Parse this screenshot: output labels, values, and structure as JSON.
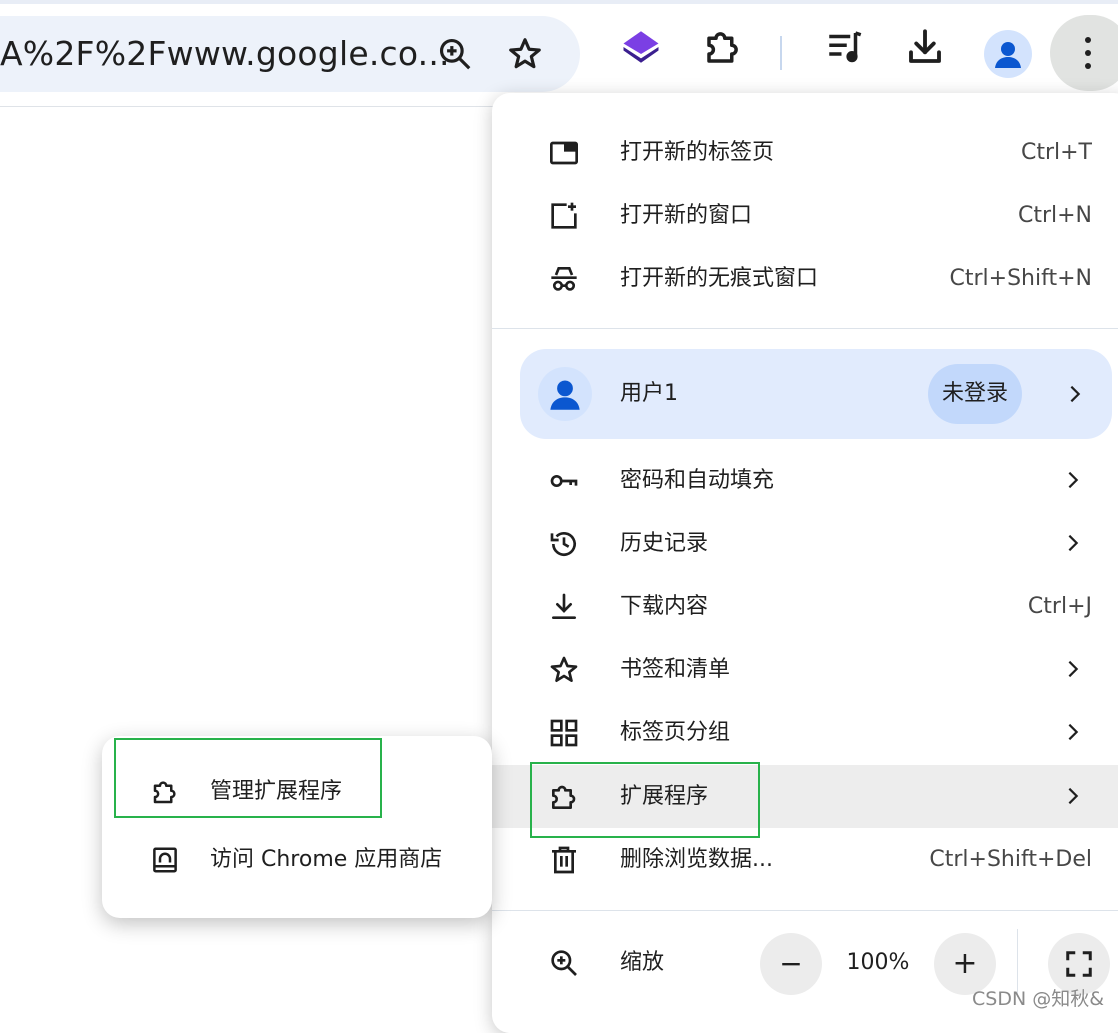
{
  "toolbar": {
    "url": "A%2F%2Fwww.google.co...",
    "icons": [
      "zoom-in-icon",
      "bookmark-star-icon",
      "extension-app-icon",
      "extensions-icon",
      "media-playlist-icon",
      "download-icon",
      "profile-avatar-icon",
      "more-menu-icon"
    ]
  },
  "menu": {
    "new_tab": {
      "label": "打开新的标签页",
      "shortcut": "Ctrl+T"
    },
    "new_window": {
      "label": "打开新的窗口",
      "shortcut": "Ctrl+N"
    },
    "incognito": {
      "label": "打开新的无痕式窗口",
      "shortcut": "Ctrl+Shift+N"
    },
    "profile": {
      "name": "用户1",
      "status": "未登录"
    },
    "passwords": {
      "label": "密码和自动填充"
    },
    "history": {
      "label": "历史记录"
    },
    "downloads": {
      "label": "下载内容",
      "shortcut": "Ctrl+J"
    },
    "bookmarks": {
      "label": "书签和清单"
    },
    "tab_groups": {
      "label": "标签页分组"
    },
    "extensions": {
      "label": "扩展程序"
    },
    "clear_data": {
      "label": "删除浏览数据...",
      "shortcut": "Ctrl+Shift+Del"
    },
    "zoom": {
      "label": "缩放",
      "minus": "−",
      "value": "100%",
      "plus": "+"
    }
  },
  "submenu": {
    "manage": "管理扩展程序",
    "store": "访问 Chrome 应用商店"
  },
  "colors": {
    "highlight_box": "#28b24b",
    "profile_bg": "#e1ebfd",
    "accent_blue": "#0b57d0",
    "hover_row": "#ededed"
  },
  "watermark": "CSDN @知秋&"
}
